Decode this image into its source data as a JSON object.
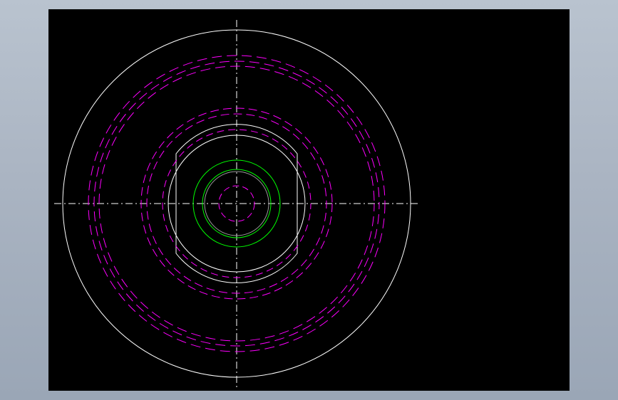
{
  "drawing": {
    "background_color": "#000000",
    "frame_color": "#b0bac8",
    "line_colors": {
      "outline": "#ffffff",
      "hidden": "#ff00ff",
      "highlight": "#00ff00",
      "centerline": "#ffffff"
    }
  }
}
